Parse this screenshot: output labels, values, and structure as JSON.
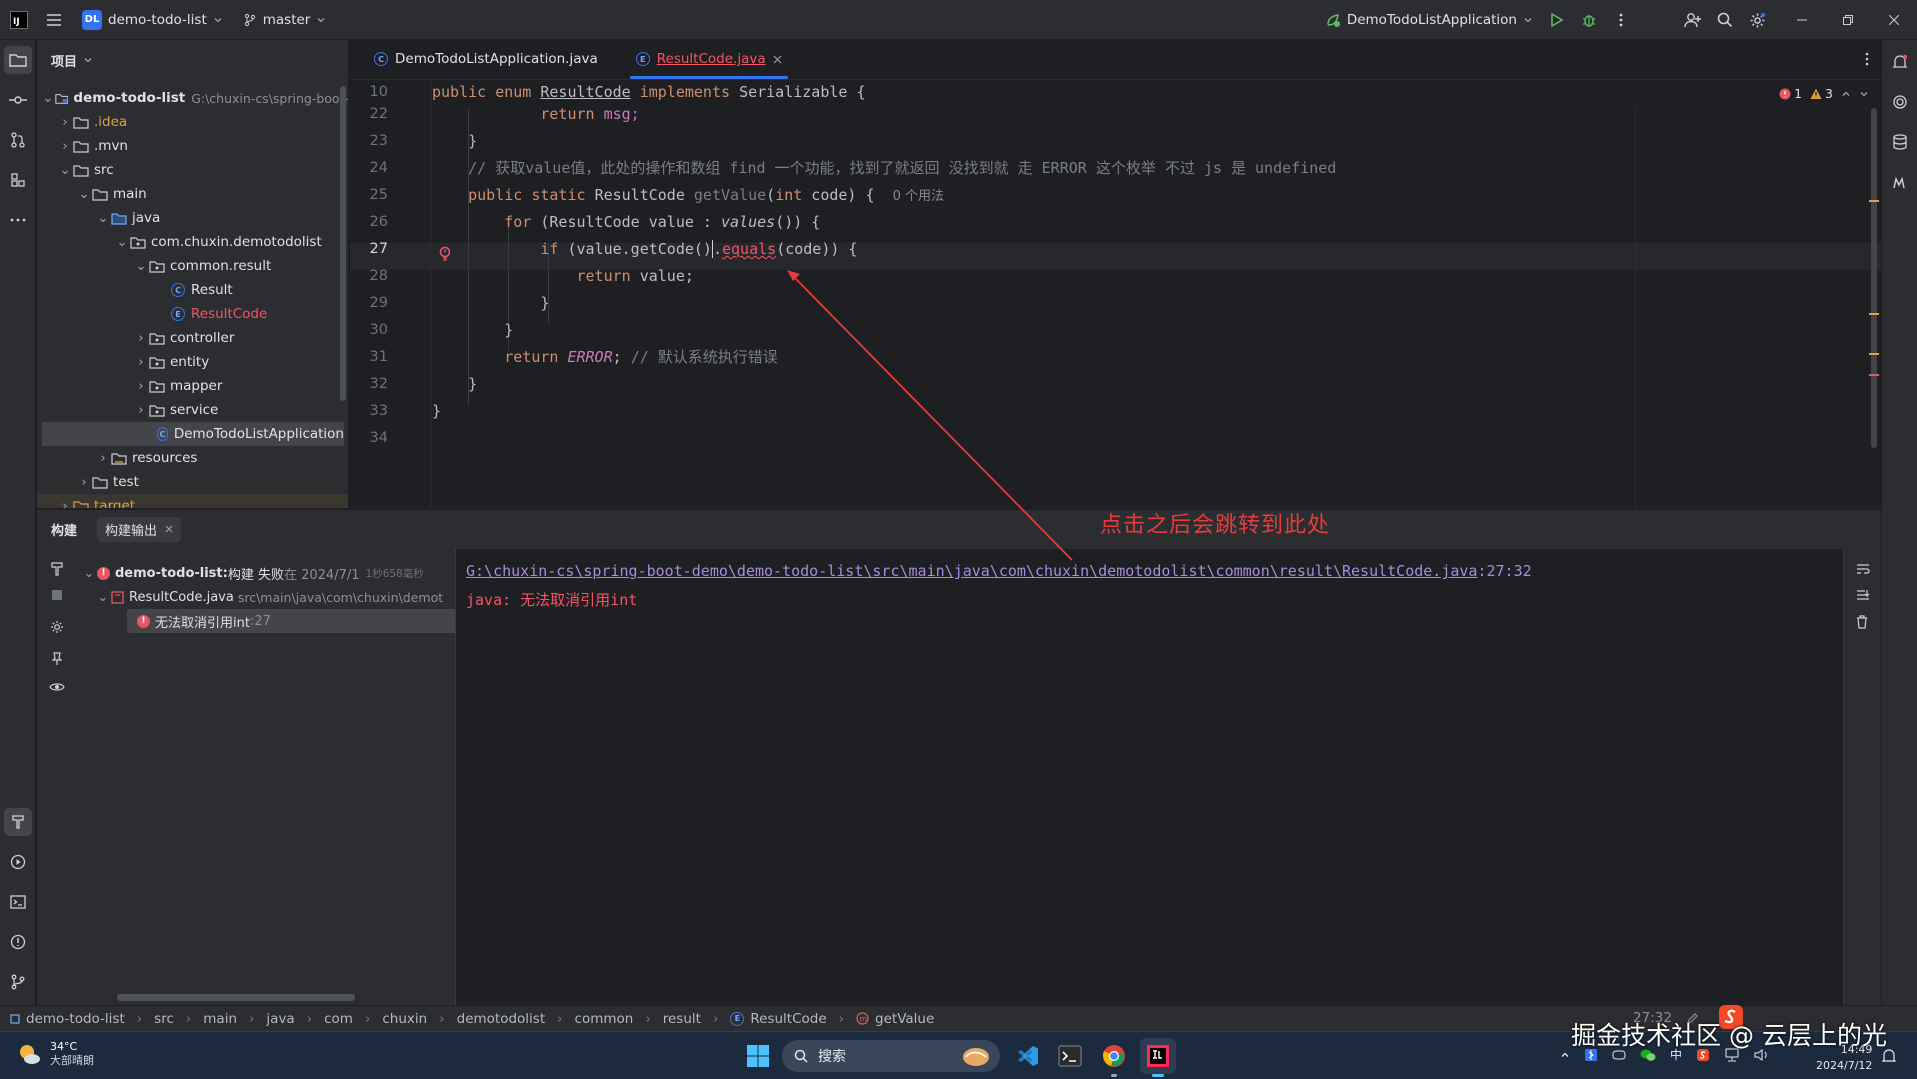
{
  "titlebar": {
    "logo": "IJ",
    "project_badge": "DL",
    "project_name": "demo-todo-list",
    "branch": "master",
    "run_config": "DemoTodoListApplication"
  },
  "project_panel": {
    "title": "项目",
    "tree": [
      {
        "label": "demo-todo-list",
        "extra": "G:\\chuxin-cs\\spring-boot-",
        "bold": true
      },
      {
        "label": ".idea"
      },
      {
        "label": ".mvn"
      },
      {
        "label": "src"
      },
      {
        "label": "main"
      },
      {
        "label": "java"
      },
      {
        "label": "com.chuxin.demotodolist"
      },
      {
        "label": "common.result"
      },
      {
        "label": "Result"
      },
      {
        "label": "ResultCode"
      },
      {
        "label": "controller"
      },
      {
        "label": "entity"
      },
      {
        "label": "mapper"
      },
      {
        "label": "service"
      },
      {
        "label": "DemoTodoListApplication"
      },
      {
        "label": "resources"
      },
      {
        "label": "test"
      },
      {
        "label": "target"
      }
    ]
  },
  "editor": {
    "tabs": [
      {
        "label": "DemoTodoListApplication.java"
      },
      {
        "label": "ResultCode.java"
      }
    ],
    "inspections": {
      "errors": "1",
      "warnings": "3"
    },
    "line_numbers": [
      "10",
      "22",
      "23",
      "24",
      "25",
      "26",
      "27",
      "28",
      "29",
      "30",
      "31",
      "32",
      "33",
      "34"
    ],
    "code": {
      "l10_a": "public enum ",
      "l10_b": "ResultCode",
      "l10_c": " implements ",
      "l10_d": "Serializable {",
      "l22_a": "    return ",
      "l22_b": "msg;",
      "l23": "}",
      "l24": "// 获取value值，此处的操作和数组 find 一个功能，找到了就返回 没找到就 走 ERROR 这个枚举 不过 js 是 undefined",
      "l25_a": "public static ",
      "l25_b": "ResultCode ",
      "l25_c": "getValue",
      "l25_d": "(",
      "l25_e": "int",
      "l25_f": " code) {  ",
      "l25_hint": "0 个用法",
      "l26_a": "for ",
      "l26_b": "(ResultCode value : ",
      "l26_c": "values",
      "l26_d": "()) {",
      "l27_a": "if ",
      "l27_b": "(value.getCode()",
      "l27_c": ".",
      "l27_d": "equals",
      "l27_e": "(code)) {",
      "l28_a": "return ",
      "l28_b": "value;",
      "l29": "}",
      "l30": "}",
      "l31_a": "return ",
      "l31_b": "ERROR",
      "l31_c": "; ",
      "l31_d": "// 默认系统执行错误",
      "l32": "}",
      "l33": "}"
    }
  },
  "build_panel": {
    "tabs": [
      "构建",
      "构建输出"
    ],
    "tree": {
      "root_label": "demo-todo-list:",
      "root_status": " 构建 失败",
      "root_time": " 在 2024/7/1",
      "root_duration": "1秒658毫秒",
      "file_label": "ResultCode.java",
      "file_path": "src\\main\\java\\com\\chuxin\\demot",
      "error_label": "无法取消引用int",
      "error_line": ":27"
    },
    "output": {
      "link": "G:\\chuxin-cs\\spring-boot-demo\\demo-todo-list\\src\\main\\java\\com\\chuxin\\demotodolist\\common\\result\\ResultCode.java",
      "link_suffix": ":27:32",
      "message": "java: 无法取消引用int"
    }
  },
  "annotation": "点击之后会跳转到此处",
  "statusbar": {
    "breadcrumbs": [
      "demo-todo-list",
      "src",
      "main",
      "java",
      "com",
      "chuxin",
      "demotodolist",
      "common",
      "result",
      "ResultCode",
      "getValue"
    ],
    "position": "27:32"
  },
  "taskbar": {
    "weather_temp": "34°C",
    "weather_desc": "大部晴朗",
    "search_placeholder": "搜索",
    "time": "14:49",
    "date": "2024/7/12",
    "ime": "中",
    "watermark": "掘金技术社区 @ 云层上的光"
  },
  "colors": {
    "accent": "#3574f0",
    "error": "#f75464",
    "annotation": "#e83b3b"
  }
}
